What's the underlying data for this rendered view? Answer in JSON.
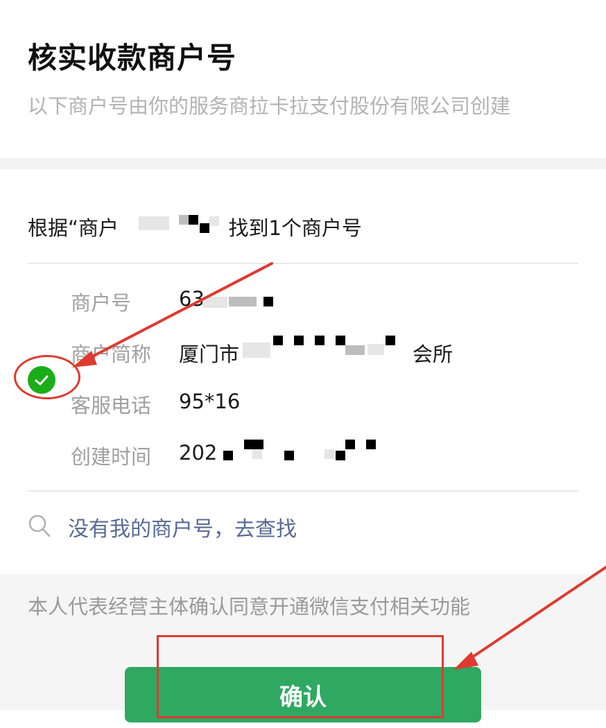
{
  "header": {
    "title": "核实收款商户号",
    "subtitle": "以下商户号由你的服务商拉卡拉支付股份有限公司创建"
  },
  "result": {
    "found_prefix": "根据“商户",
    "found_suffix": "找到1个商户号"
  },
  "merchant": {
    "rows": [
      {
        "label": "商户号",
        "value": "63"
      },
      {
        "label": "商户简称",
        "value_prefix": "厦门市",
        "value_suffix": "会所"
      },
      {
        "label": "客服电话",
        "value": "95*16"
      },
      {
        "label": "创建时间",
        "value": "202"
      }
    ],
    "selected": true
  },
  "search_link": {
    "label": "没有我的商户号，去查找",
    "icon": "search-icon"
  },
  "consent_text": "本人代表经营主体确认同意开通微信支付相关功能",
  "confirm_button": {
    "label": "确认"
  },
  "colors": {
    "primary_green": "#2fa862",
    "check_green": "#1aad19",
    "link_blue": "#576b95",
    "annotation_red": "#e03a2f"
  }
}
